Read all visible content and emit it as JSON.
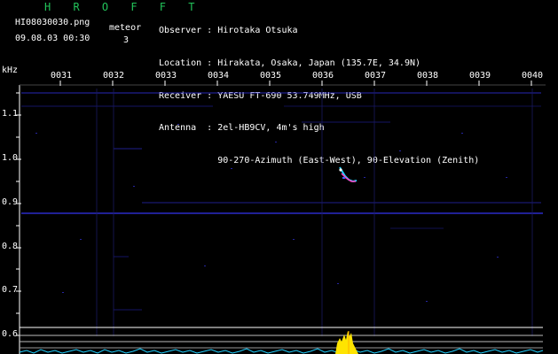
{
  "header": {
    "brand": "H R O F F T",
    "filename": "HI08030030.png",
    "timestamp": "09.08.03 00:30",
    "meteor_label": "meteor",
    "meteor_count": "3"
  },
  "info": {
    "observer": "Observer : Hirotaka Otsuka",
    "location": "Location : Hirakata, Osaka, Japan (135.7E, 34.9N)",
    "receiver": "Receiver : YAESU FT-690 53.749MHz, USB",
    "antenna": "Antenna  : 2el-HB9CV, 4m's high",
    "antenna2": "           90-270-Azimuth (East-West), 90-Elevation (Zenith)"
  },
  "axis": {
    "y_unit": "kHz",
    "x_ticks": [
      "0031",
      "0032",
      "0033",
      "0034",
      "0035",
      "0036",
      "0037",
      "0038",
      "0039",
      "0040"
    ],
    "y_ticks": [
      "1.1",
      "1.0",
      "0.9",
      "0.8",
      "0.7",
      "0.6"
    ]
  },
  "colors": {
    "background": "#000000",
    "brand": "#22c35a",
    "signal_blue": "#2b2bc8",
    "signal_cyan": "#20d0ff",
    "signal_magenta": "#ff40c0",
    "signal_yellow": "#ffe400"
  }
}
